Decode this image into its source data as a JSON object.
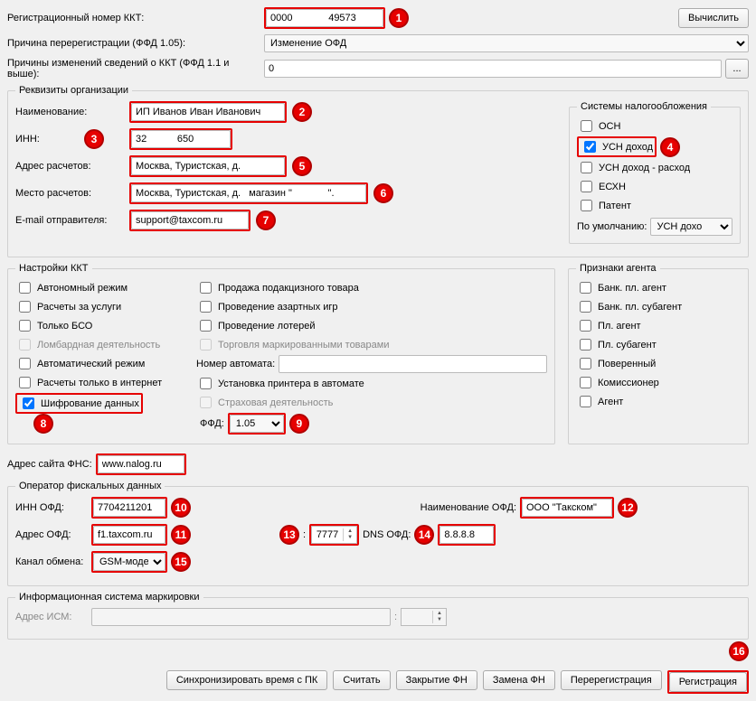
{
  "top": {
    "reg_num_label": "Регистрационный номер ККТ:",
    "reg_num_value": "0000             49573",
    "calc_btn": "Вычислить",
    "rereg_reason_label": "Причина перерегистрации (ФФД 1.05):",
    "rereg_reason_value": "Изменение ОФД",
    "change_reasons_label": "Причины изменений сведений о ККТ (ФФД 1.1 и выше):",
    "change_reasons_value": "0",
    "ellipsis": "..."
  },
  "org": {
    "legend": "Реквизиты организации",
    "name_label": "Наименование:",
    "name_value": "ИП Иванов Иван Иванович",
    "inn_label": "ИНН:",
    "inn_value": "32           650",
    "addr_label": "Адрес расчетов:",
    "addr_value": "Москва, Туристская, д.  ",
    "place_label": "Место расчетов:",
    "place_value": "Москва, Туристская, д.   магазин \"             \".",
    "email_label": "E-mail отправителя:",
    "email_value": "support@taxcom.ru",
    "tax_legend": "Системы налогообложения",
    "tax_items": [
      "ОСН",
      "УСН доход",
      "УСН доход - расход",
      "ЕСХН",
      "Патент"
    ],
    "tax_checked_index": 1,
    "tax_default_label": "По умолчанию:",
    "tax_default_value": "УСН дохо"
  },
  "kkt": {
    "legend": "Настройки ККТ",
    "left": [
      "Автономный режим",
      "Расчеты за услуги",
      "Только БСО",
      "Ломбардная деятельность",
      "Автоматический режим",
      "Расчеты только в интернет",
      "Шифрование данных"
    ],
    "left_disabled_index": 3,
    "left_checked_index": 6,
    "right": [
      "Продажа подакцизного товара",
      "Проведение азартных игр",
      "Проведение лотерей",
      "Торговля маркированными товарами"
    ],
    "right_disabled_index": 3,
    "automat_label": "Номер автомата:",
    "printer_label": "Установка принтера в автомате",
    "ins_label": "Страховая деятельность",
    "ffd_label": "ФФД:",
    "ffd_value": "1.05",
    "agent_legend": "Признаки агента",
    "agents": [
      "Банк. пл. агент",
      "Банк. пл. субагент",
      "Пл. агент",
      "Пл. субагент",
      "Поверенный",
      "Комиссионер",
      "Агент"
    ]
  },
  "fns": {
    "label": "Адрес сайта ФНС:",
    "value": "www.nalog.ru"
  },
  "ofd": {
    "legend": "Оператор фискальных данных",
    "inn_label": "ИНН ОФД:",
    "inn_value": "7704211201",
    "addr_label": "Адрес ОФД:",
    "addr_value": "f1.taxcom.ru",
    "port_value": "7777",
    "dns_label": "DNS ОФД:",
    "dns_value": "8.8.8.8",
    "name_label": "Наименование ОФД:",
    "name_value": "ООО \"Такском\"",
    "chan_label": "Канал обмена:",
    "chan_value": "GSM-модем"
  },
  "ism": {
    "legend": "Информационная система маркировки",
    "addr_label": "Адрес ИСМ:"
  },
  "btns": {
    "sync": "Синхронизировать время с ПК",
    "read": "Считать",
    "close": "Закрытие ФН",
    "replace": "Замена ФН",
    "rereg": "Перерегистрация",
    "reg": "Регистрация"
  },
  "badges": {
    "1": "1",
    "2": "2",
    "3": "3",
    "4": "4",
    "5": "5",
    "6": "6",
    "7": "7",
    "8": "8",
    "9": "9",
    "10": "10",
    "11": "11",
    "12": "12",
    "13": "13",
    "14": "14",
    "15": "15",
    "16": "16"
  }
}
